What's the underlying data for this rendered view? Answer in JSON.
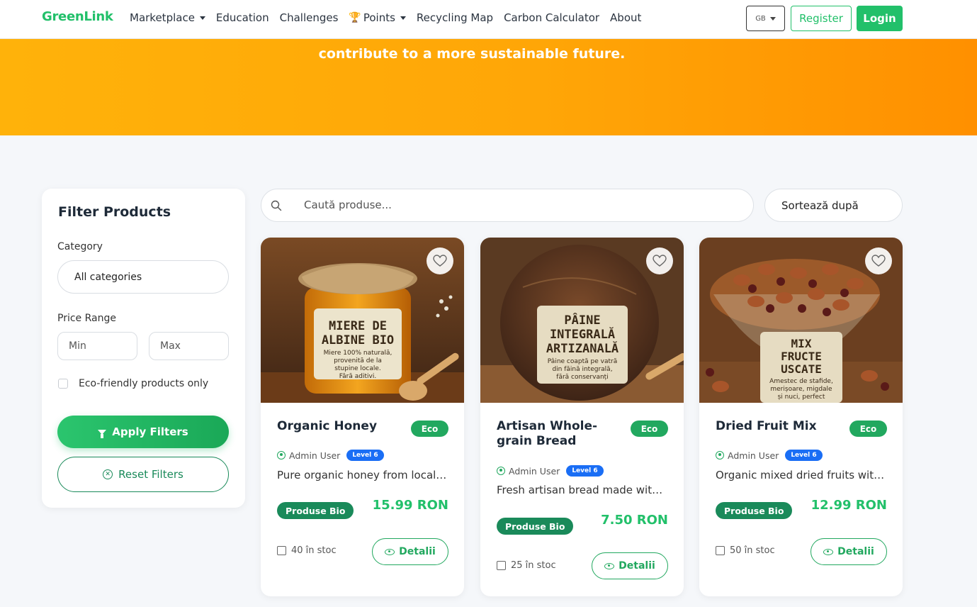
{
  "nav": {
    "brand": "GreenLink",
    "links": [
      {
        "label": "Marketplace",
        "dropdown": true
      },
      {
        "label": "Education"
      },
      {
        "label": "Challenges"
      },
      {
        "label": "Points",
        "dropdown": true,
        "icon": "trophy-icon"
      },
      {
        "label": "Recycling Map"
      },
      {
        "label": "Carbon Calculator"
      },
      {
        "label": "About"
      }
    ],
    "language": "GB",
    "register": "Register",
    "login": "Login"
  },
  "hero": {
    "text": "contribute to a more sustainable future."
  },
  "filters": {
    "title": "Filter Products",
    "category_label": "Category",
    "category_value": "All categories",
    "price_label": "Price Range",
    "min_placeholder": "Min",
    "max_placeholder": "Max",
    "eco_only_label": "Eco-friendly products only",
    "apply": "Apply Filters",
    "reset": "Reset Filters"
  },
  "search": {
    "placeholder": "Caută produse...",
    "sort_label": "Sortează după"
  },
  "products": [
    {
      "title": "Organic Honey",
      "eco": "Eco",
      "author": "Admin User",
      "level": "Level 6",
      "description": "Pure organic honey from local beekeepers",
      "category": "Produse Bio",
      "price": "15.99 RON",
      "stock": "40 în stoc",
      "details": "Detalii",
      "image_label": [
        "MIERE DE",
        "ALBINE BIO"
      ],
      "image_sublabel": [
        "Miere 100% naturală,",
        "provenită de la",
        "stupine locale.",
        "Fără aditivi."
      ]
    },
    {
      "title": "Artisan Whole-grain Bread",
      "eco": "Eco",
      "author": "Admin User",
      "level": "Level 6",
      "description": "Fresh artisan bread made with whole-grain flour",
      "category": "Produse Bio",
      "price": "7.50 RON",
      "stock": "25 în stoc",
      "details": "Detalii",
      "image_label": [
        "PÂINE",
        "INTEGRALĂ",
        "ARTIZANALĂ"
      ],
      "image_sublabel": [
        "Pâine coaptă pe vatră",
        "din făină integrală,",
        "fără conservanți"
      ]
    },
    {
      "title": "Dried Fruit Mix",
      "eco": "Eco",
      "author": "Admin User",
      "level": "Level 6",
      "description": "Organic mixed dried fruits with nuts",
      "category": "Produse Bio",
      "price": "12.99 RON",
      "stock": "50 în stoc",
      "details": "Detalii",
      "image_label": [
        "MIX",
        "FRUCTE",
        "USCATE"
      ],
      "image_sublabel": [
        "Amestec de stafide,",
        "merișoare, migdale",
        "și nuci, perfect"
      ]
    }
  ],
  "colors": {
    "brand_green": "#22c06a",
    "hero_orange": "#ffa607",
    "level_blue": "#1a6ef5",
    "badge_green": "#1a8a5a"
  }
}
